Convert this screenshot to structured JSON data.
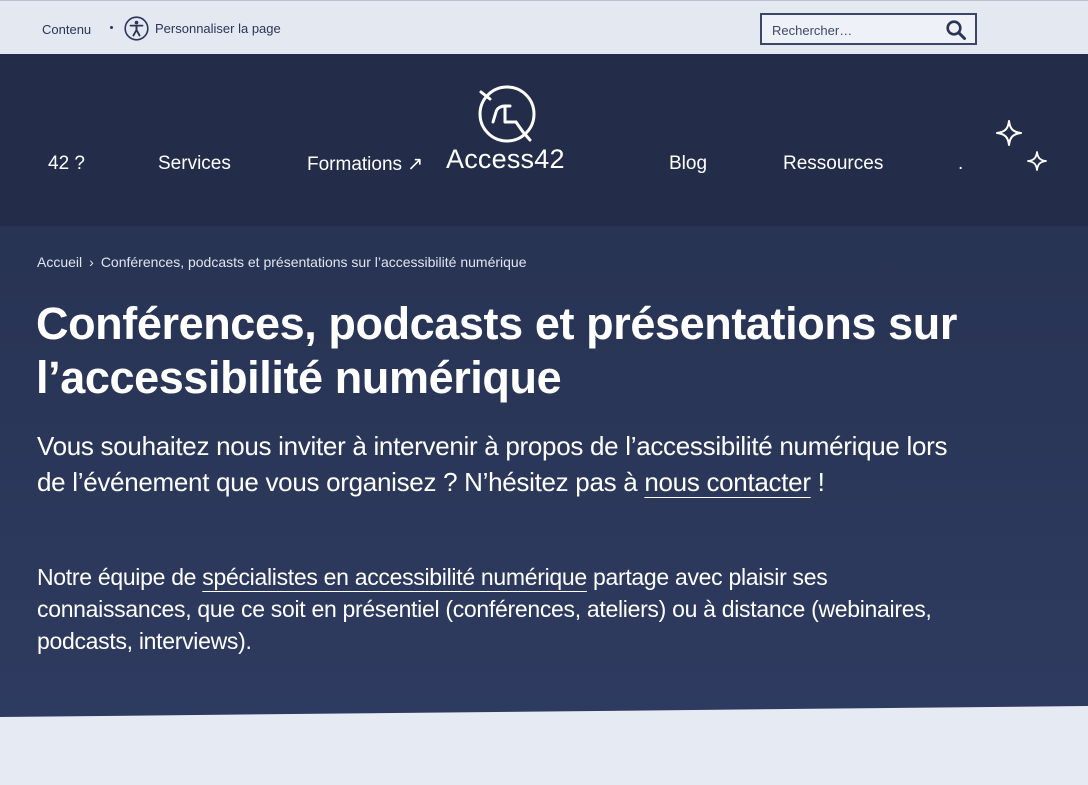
{
  "topbar": {
    "skip_link": "Contenu",
    "customize_label": "Personnaliser la page",
    "search_placeholder": "Rechercher…"
  },
  "nav": {
    "items": [
      "42 ?",
      "Services",
      "Formations ↗",
      "Blog",
      "Ressources",
      "."
    ],
    "logo_text": "Access42"
  },
  "breadcrumb": {
    "home": "Accueil",
    "separator": "›",
    "current": "Conférences, podcasts et présentations sur l’accessibilité numérique"
  },
  "page": {
    "title": "Conférences, podcasts et présentations sur l’accessibilité numérique",
    "lead_before": "Vous souhaitez nous inviter à intervenir à propos de l’accessibilité numérique lors de l’événement que vous organisez ? N’hésitez pas à ",
    "lead_link": "nous contacter",
    "lead_after": " !",
    "body_before": "Notre équipe de ",
    "body_link": "spécialistes en accessibilité numérique",
    "body_after": " partage avec plaisir ses connaissances, que ce soit en présentiel (conférences, ateliers) ou à distance (webinaires, podcasts, interviews)."
  },
  "icons": {
    "accessibility": "accessibility-person-icon",
    "search": "magnifier-icon",
    "logo": "access42-logo-icon",
    "sparkle": "sparkle-icon"
  },
  "colors": {
    "hero_bg": "#2b3759",
    "nav_bg": "#232d4a",
    "topbar_bg": "#e3e8f1",
    "text_light": "#ffffff"
  }
}
